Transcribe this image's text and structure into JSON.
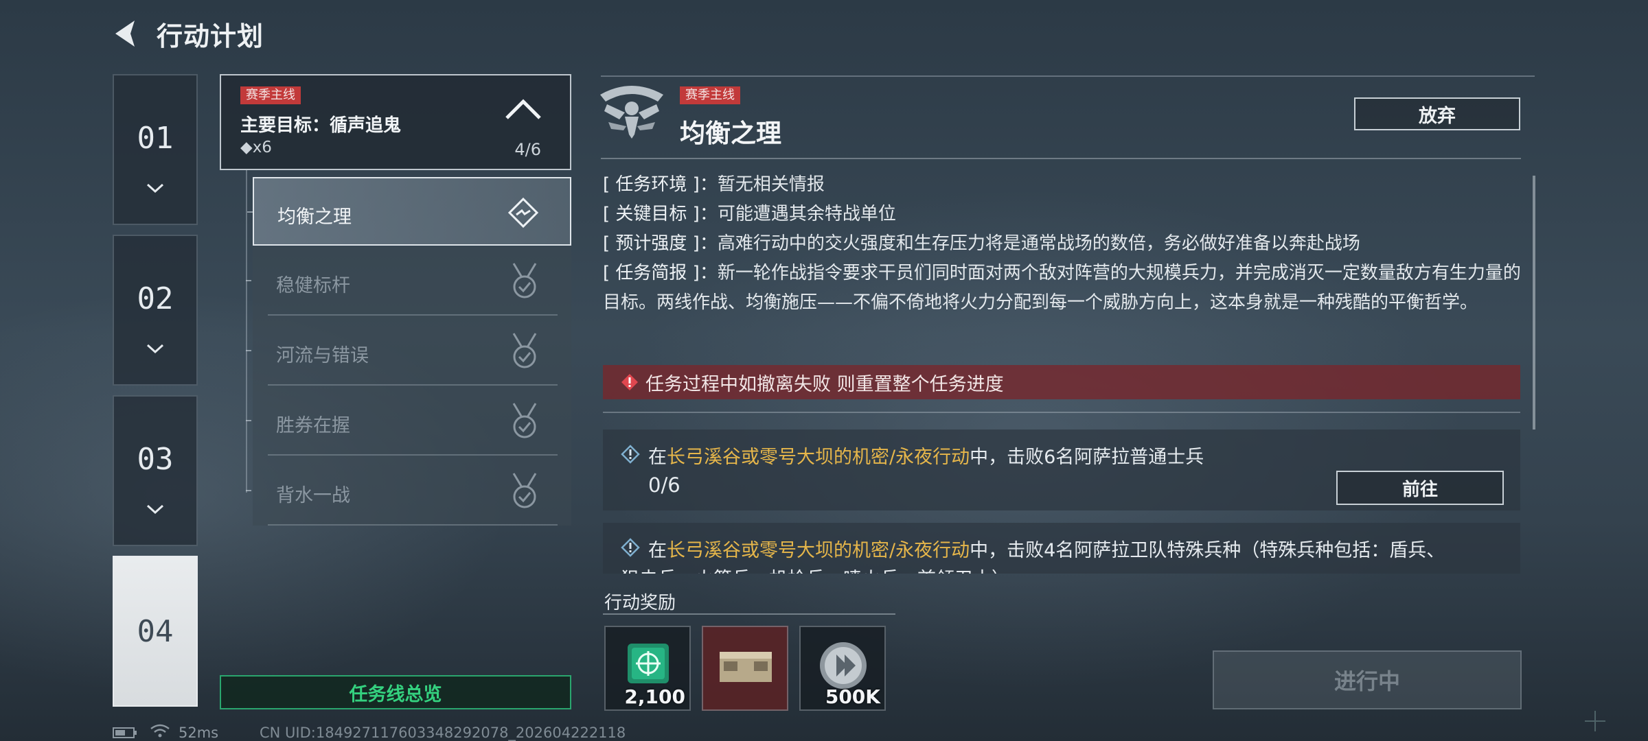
{
  "header": {
    "title": "行动计划"
  },
  "chapters": [
    {
      "num": "01"
    },
    {
      "num": "02"
    },
    {
      "num": "03"
    },
    {
      "num": "04"
    }
  ],
  "objective": {
    "tag": "赛季主线",
    "title": "主要目标：循声追鬼",
    "count": "◆x6",
    "progress": "4/6"
  },
  "subquests": [
    {
      "label": "均衡之理"
    },
    {
      "label": "稳健标杆"
    },
    {
      "label": "河流与错误"
    },
    {
      "label": "胜券在握"
    },
    {
      "label": "背水一战"
    }
  ],
  "overview_button": "任务线总览",
  "detail": {
    "tag": "赛季主线",
    "title": "均衡之理",
    "abandon": "放弃",
    "env_key": "[ 任务环境 ]：",
    "env_val": "暂无相关情报",
    "target_key": "[ 关键目标 ]：",
    "target_val": "可能遭遇其余特战单位",
    "intensity_key": "[ 预计强度 ]：",
    "intensity_val": "高难行动中的交火强度和生存压力将是通常战场的数倍，务必做好准备以奔赴战场",
    "brief_key": "[ 任务简报 ]：",
    "brief_val": "新一轮作战指令要求干员们同时面对两个敌对阵营的大规模兵力，并完成消灭一定数量敌方有生力量的目标。两线作战、均衡施压——不偏不倚地将火力分配到每一个威胁方向上，这本身就是一种残酷的平衡哲学。",
    "warning": "任务过程中如撤离失败 则重置整个任务进度"
  },
  "tasks": [
    {
      "pre": "在",
      "highlight": "长弓溪谷或零号大坝的机密/永夜行动",
      "post": "中，击败6名阿萨拉普通士兵",
      "progress": "0/6",
      "goto": "前往"
    },
    {
      "pre": "在",
      "highlight": "长弓溪谷或零号大坝的机密/永夜行动",
      "post": "中，击败4名阿萨拉卫队特殊兵种（特殊兵种包括：盾兵、",
      "line2": "狙击兵、火箭兵、机枪兵、喷火兵、首领卫士）"
    }
  ],
  "rewards": {
    "label": "行动奖励",
    "items": [
      {
        "icon": "supply-crate-icon",
        "qty": "2,100"
      },
      {
        "icon": "ammo-box-icon",
        "qty": ""
      },
      {
        "icon": "coin-icon",
        "qty": "500K"
      }
    ]
  },
  "in_progress_button": "进行中",
  "status": {
    "ping": "52ms",
    "uid": "CN UID:184927117603348292078_202604222118"
  },
  "colors": {
    "accent_green": "#34d17f",
    "season_red": "#c23a3a",
    "highlight_gold": "#e6b64a",
    "warning_red": "#78262c"
  }
}
